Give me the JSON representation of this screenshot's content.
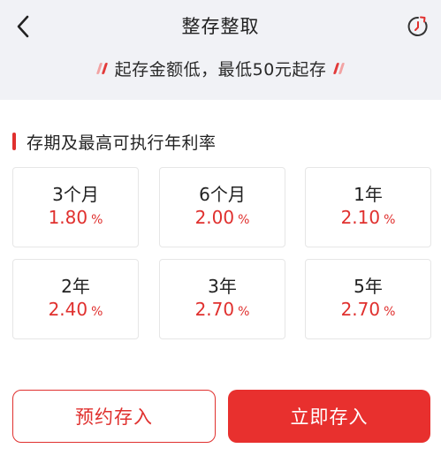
{
  "header": {
    "title": "整存整取",
    "back_icon": "chevron-left-icon",
    "history_icon": "history-clock-icon"
  },
  "notice": {
    "text": "起存金额低，最低50元起存"
  },
  "section": {
    "title": "存期及最高可执行年利率"
  },
  "terms": [
    {
      "term": "3个月",
      "rate": "1.80",
      "unit": "%"
    },
    {
      "term": "6个月",
      "rate": "2.00",
      "unit": "%"
    },
    {
      "term": "1年",
      "rate": "2.10",
      "unit": "%"
    },
    {
      "term": "2年",
      "rate": "2.40",
      "unit": "%"
    },
    {
      "term": "3年",
      "rate": "2.70",
      "unit": "%"
    },
    {
      "term": "5年",
      "rate": "2.70",
      "unit": "%"
    }
  ],
  "actions": {
    "reserve_label": "预约存入",
    "deposit_label": "立即存入"
  },
  "colors": {
    "accent": "#e0302e",
    "top_background": "#f1f2f6",
    "card_border": "#e6e6e6"
  }
}
